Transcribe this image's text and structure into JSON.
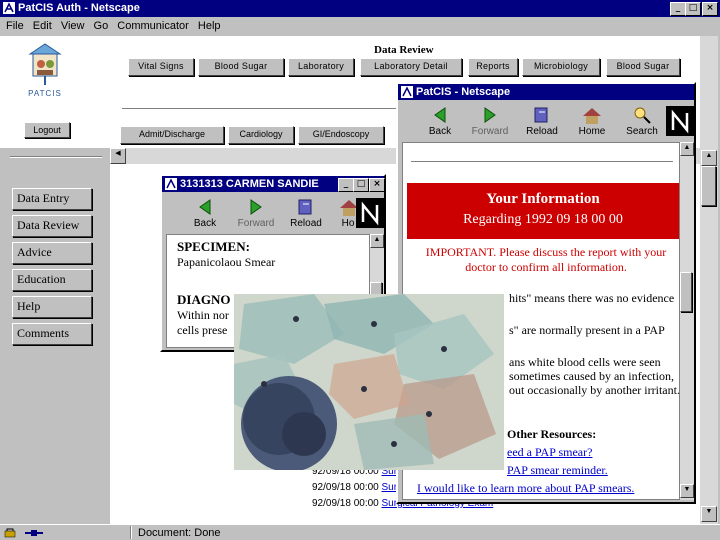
{
  "main_window": {
    "title": "PatCIS Auth - Netscape",
    "menu": [
      "File",
      "Edit",
      "View",
      "Go",
      "Communicator",
      "Help"
    ],
    "status_text": "Document: Done"
  },
  "header": {
    "logo_text": "PATCIS",
    "data_review_label": "Data Review",
    "tabs_row1": [
      "Vital Signs",
      "Blood Sugar",
      "Laboratory",
      "Laboratory Detail",
      "Reports",
      "Microbiology",
      "Blood Sugar"
    ],
    "tabs_row2": [
      "Admit/Discharge",
      "Cardiology",
      "GI/Endoscopy"
    ],
    "logout_label": "Logout"
  },
  "sidebar": {
    "items": [
      "Data Entry",
      "Data Review",
      "Advice",
      "Education",
      "Help",
      "Comments"
    ]
  },
  "reports_list": {
    "rows": [
      {
        "date": "92/09/18 00:00",
        "link": "Sur"
      },
      {
        "date": "92/09/18 00:00",
        "link": "Sur"
      },
      {
        "date": "92/09/18 00:00",
        "link": "Surgical Pathology Exam"
      }
    ]
  },
  "carmen_window": {
    "title": "3131313 CARMEN SANDIE",
    "toolbar": [
      "Back",
      "Forward",
      "Reload",
      "Ho"
    ],
    "specimen_heading": "SPECIMEN:",
    "specimen_value": "Papanicolaou Smear",
    "diagnosis_heading": "DIAGNO",
    "diagnosis_line1": "Within nor",
    "diagnosis_line2": "cells prese"
  },
  "patcis_window": {
    "title": "PatCIS - Netscape",
    "toolbar": [
      "Back",
      "Forward",
      "Reload",
      "Home",
      "Search"
    ],
    "banner_title": "Your Information",
    "banner_subtitle": "Regarding 1992 09 18 00 00",
    "important_text": "IMPORTANT. Please discuss the report with your doctor to confirm all information.",
    "partial_lines": [
      "hits\" means there was no evidence",
      "s\" are normally present in a PAP",
      "ans white blood cells were seen",
      "sometimes caused by an infection,",
      "out occasionally by another irritant."
    ],
    "other_resources_heading": "Other Resources:",
    "resource_links": [
      "eed a PAP smear?",
      "PAP smear reminder.",
      "I would like to learn more about PAP smears."
    ]
  },
  "colors": {
    "titlebar": "#000080",
    "banner_red": "#cc0000",
    "link_blue": "#0000cc",
    "desktop_gray": "#c0c0c0"
  }
}
